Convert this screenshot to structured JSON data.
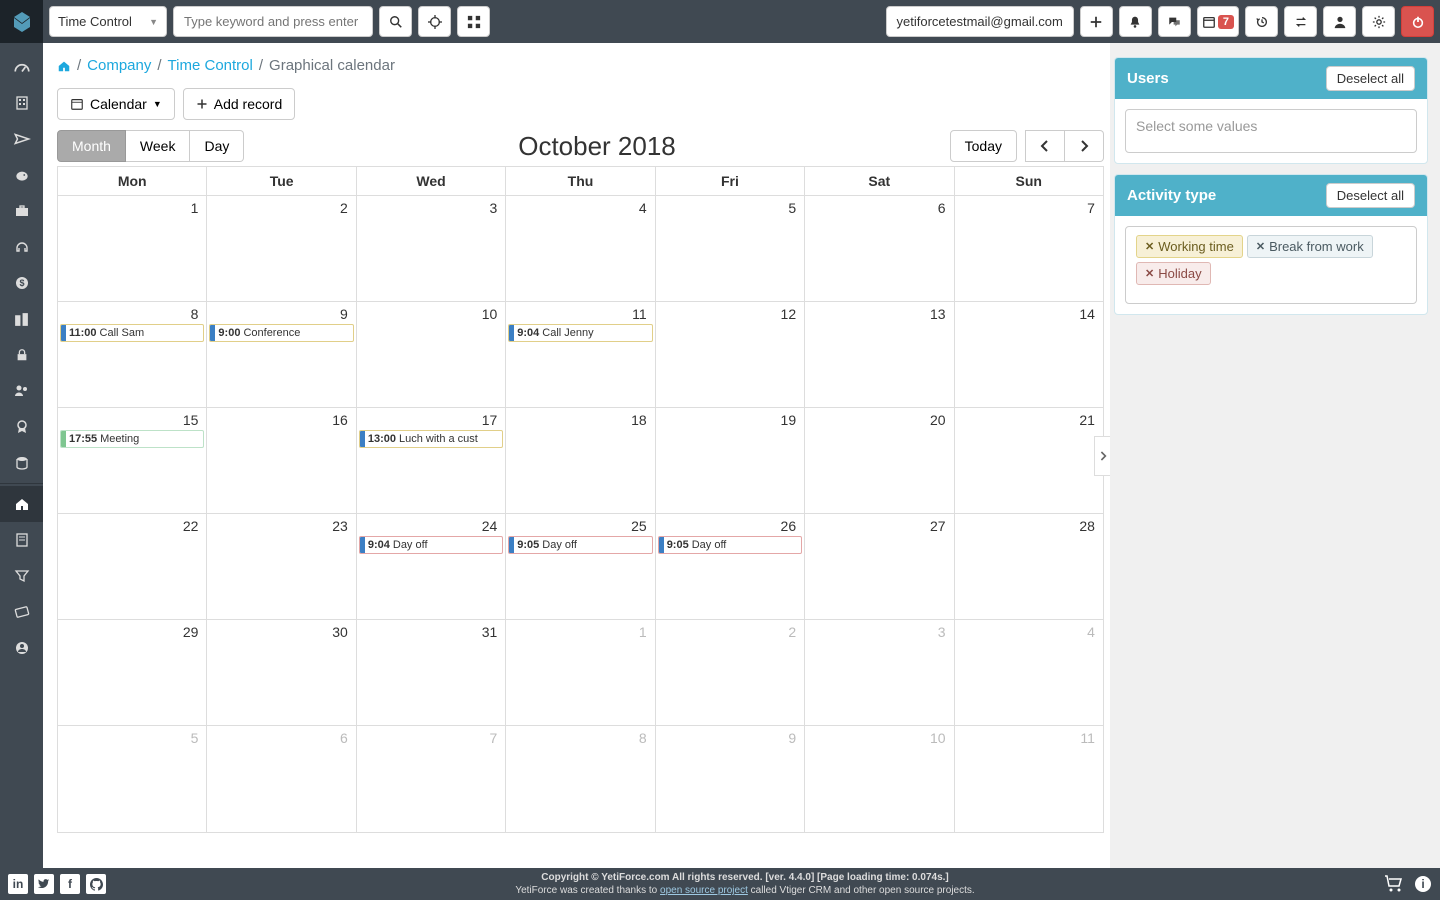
{
  "topbar": {
    "module": "Time Control",
    "search_placeholder": "Type keyword and press enter",
    "user_email": "yetiforcetestmail@gmail.com",
    "cal_badge": "7"
  },
  "breadcrumb": {
    "company": "Company",
    "module": "Time Control",
    "view": "Graphical calendar"
  },
  "toolbar": {
    "calendar_label": "Calendar",
    "add_record_label": "Add record"
  },
  "calendar": {
    "views": {
      "month": "Month",
      "week": "Week",
      "day": "Day"
    },
    "title": "October 2018",
    "today": "Today",
    "day_headers": [
      "Mon",
      "Tue",
      "Wed",
      "Thu",
      "Fri",
      "Sat",
      "Sun"
    ],
    "weeks": [
      [
        {
          "n": "1"
        },
        {
          "n": "2"
        },
        {
          "n": "3"
        },
        {
          "n": "4"
        },
        {
          "n": "5"
        },
        {
          "n": "6"
        },
        {
          "n": "7"
        }
      ],
      [
        {
          "n": "8"
        },
        {
          "n": "9"
        },
        {
          "n": "10"
        },
        {
          "n": "11"
        },
        {
          "n": "12"
        },
        {
          "n": "13"
        },
        {
          "n": "14"
        }
      ],
      [
        {
          "n": "15"
        },
        {
          "n": "16"
        },
        {
          "n": "17"
        },
        {
          "n": "18"
        },
        {
          "n": "19"
        },
        {
          "n": "20"
        },
        {
          "n": "21"
        }
      ],
      [
        {
          "n": "22"
        },
        {
          "n": "23"
        },
        {
          "n": "24"
        },
        {
          "n": "25"
        },
        {
          "n": "26"
        },
        {
          "n": "27"
        },
        {
          "n": "28"
        }
      ],
      [
        {
          "n": "29"
        },
        {
          "n": "30"
        },
        {
          "n": "31"
        },
        {
          "n": "1",
          "other": true
        },
        {
          "n": "2",
          "other": true
        },
        {
          "n": "3",
          "other": true
        },
        {
          "n": "4",
          "other": true
        }
      ],
      [
        {
          "n": "5",
          "other": true
        },
        {
          "n": "6",
          "other": true
        },
        {
          "n": "7",
          "other": true
        },
        {
          "n": "8",
          "other": true
        },
        {
          "n": "9",
          "other": true
        },
        {
          "n": "10",
          "other": true
        },
        {
          "n": "11",
          "other": true
        }
      ]
    ],
    "events": [
      {
        "week": 1,
        "day": 0,
        "time": "11:00",
        "title": "Call Sam",
        "cls": "work"
      },
      {
        "week": 1,
        "day": 1,
        "time": "9:00",
        "title": "Conference",
        "cls": "work"
      },
      {
        "week": 1,
        "day": 3,
        "time": "9:04",
        "title": "Call Jenny",
        "cls": "work"
      },
      {
        "week": 2,
        "day": 0,
        "time": "17:55",
        "title": "Meeting",
        "cls": "break"
      },
      {
        "week": 2,
        "day": 2,
        "time": "13:00",
        "title": "Luch with a cust",
        "cls": "work"
      },
      {
        "week": 3,
        "day": 2,
        "time": "9:04",
        "title": "Day off",
        "cls": "holiday"
      },
      {
        "week": 3,
        "day": 3,
        "time": "9:05",
        "title": "Day off",
        "cls": "holiday"
      },
      {
        "week": 3,
        "day": 4,
        "time": "9:05",
        "title": "Day off",
        "cls": "holiday"
      }
    ]
  },
  "right": {
    "users": {
      "title": "Users",
      "deselect": "Deselect all",
      "placeholder": "Select some values"
    },
    "activity": {
      "title": "Activity type",
      "deselect": "Deselect all",
      "tags": [
        {
          "label": "Working time",
          "cls": "working"
        },
        {
          "label": "Break from work",
          "cls": "break"
        },
        {
          "label": "Holiday",
          "cls": "holiday"
        }
      ]
    }
  },
  "footer": {
    "line1_a": "Copyright © YetiForce.com All rights reserved. [ver. 4.4.0] [Page loading time: 0.074s.]",
    "line2_a": "YetiForce was created thanks to ",
    "line2_link": "open source project",
    "line2_b": " called Vtiger CRM and other open source projects."
  }
}
